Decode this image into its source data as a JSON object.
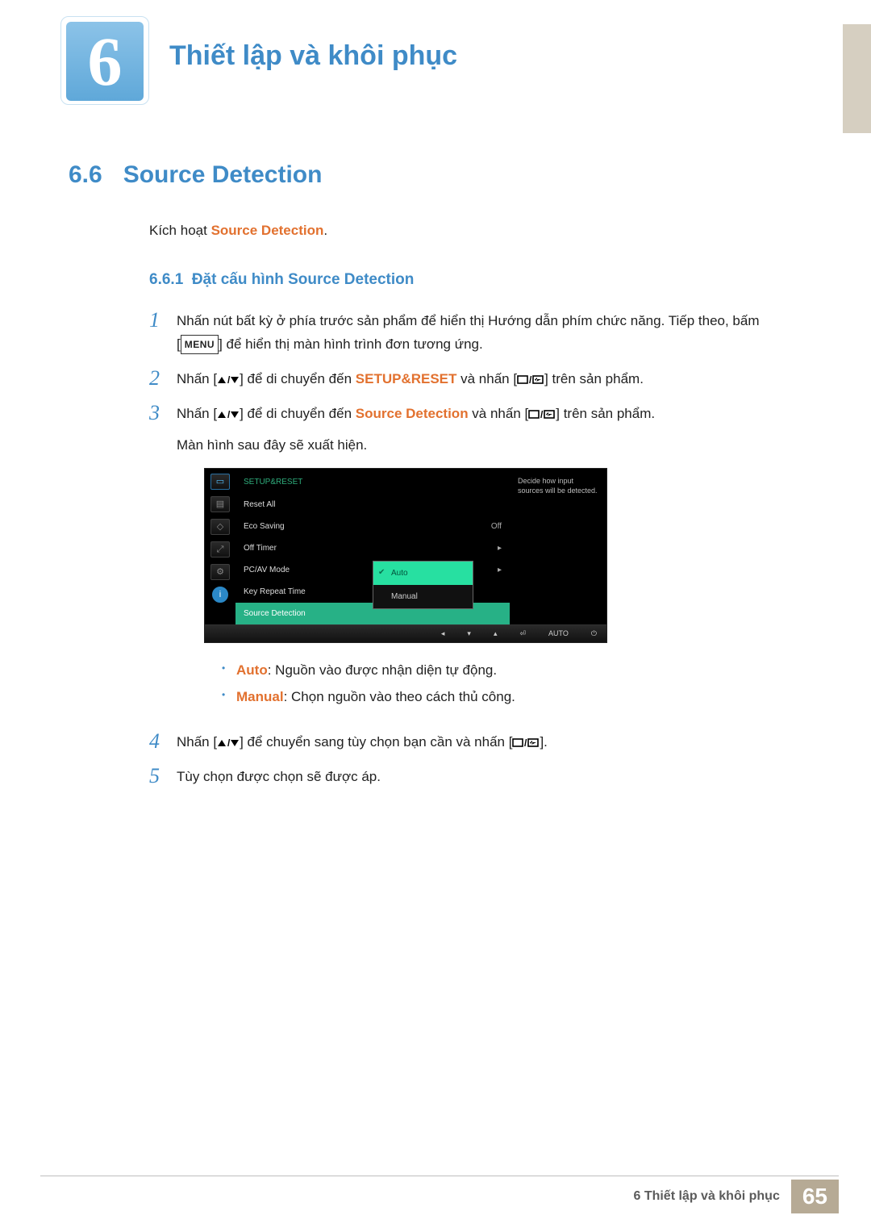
{
  "chapter": {
    "number": "6",
    "title": "Thiết lập và khôi phục"
  },
  "section": {
    "number": "6.6",
    "title": "Source Detection"
  },
  "intro": {
    "prefix": "Kích hoạt ",
    "term": "Source Detection",
    "suffix": "."
  },
  "subsection": {
    "number": "6.6.1",
    "title": "Đặt cấu hình Source Detection"
  },
  "steps": {
    "s1a": "Nhấn nút bất kỳ ở phía trước sản phẩm để hiển thị Hướng dẫn phím chức năng. Tiếp theo, bấm",
    "s1b_prefix": "[",
    "s1b_menu": "MENU",
    "s1b_suffix": "] để hiển thị màn hình trình đơn tương ứng.",
    "s2_a": "Nhấn [",
    "s2_mid1": "] để di chuyển đến ",
    "s2_term": "SETUP&RESET",
    "s2_mid2": " và nhấn [",
    "s2_end": "] trên sản phẩm.",
    "s3_a": "Nhấn [",
    "s3_mid1": "] để di chuyển đến ",
    "s3_term": "Source Detection",
    "s3_mid2": " và nhấn [",
    "s3_end": "] trên sản phẩm.",
    "s3_line2": "Màn hình sau đây sẽ xuất hiện.",
    "s4_a": "Nhấn [",
    "s4_mid": "] để chuyển sang tùy chọn bạn cần và nhấn [",
    "s4_end": "].",
    "s5": "Tùy chọn được chọn sẽ được áp."
  },
  "bullets": {
    "auto_label": "Auto",
    "auto_text": ": Nguồn vào được nhận diện tự động.",
    "manual_label": "Manual",
    "manual_text": ": Chọn nguồn vào theo cách thủ công."
  },
  "osd": {
    "title": "SETUP&RESET",
    "rows": {
      "reset": "Reset All",
      "eco": "Eco Saving",
      "eco_val": "Off",
      "timer": "Off Timer",
      "pcav": "PC/AV Mode",
      "key": "Key Repeat Time",
      "src": "Source Detection"
    },
    "submenu": {
      "auto": "Auto",
      "manual": "Manual"
    },
    "hint": "Decide how input sources will be detected.",
    "footer_auto": "AUTO"
  },
  "footer": {
    "chapter_ref": "6 Thiết lập và khôi phục",
    "page": "65"
  }
}
